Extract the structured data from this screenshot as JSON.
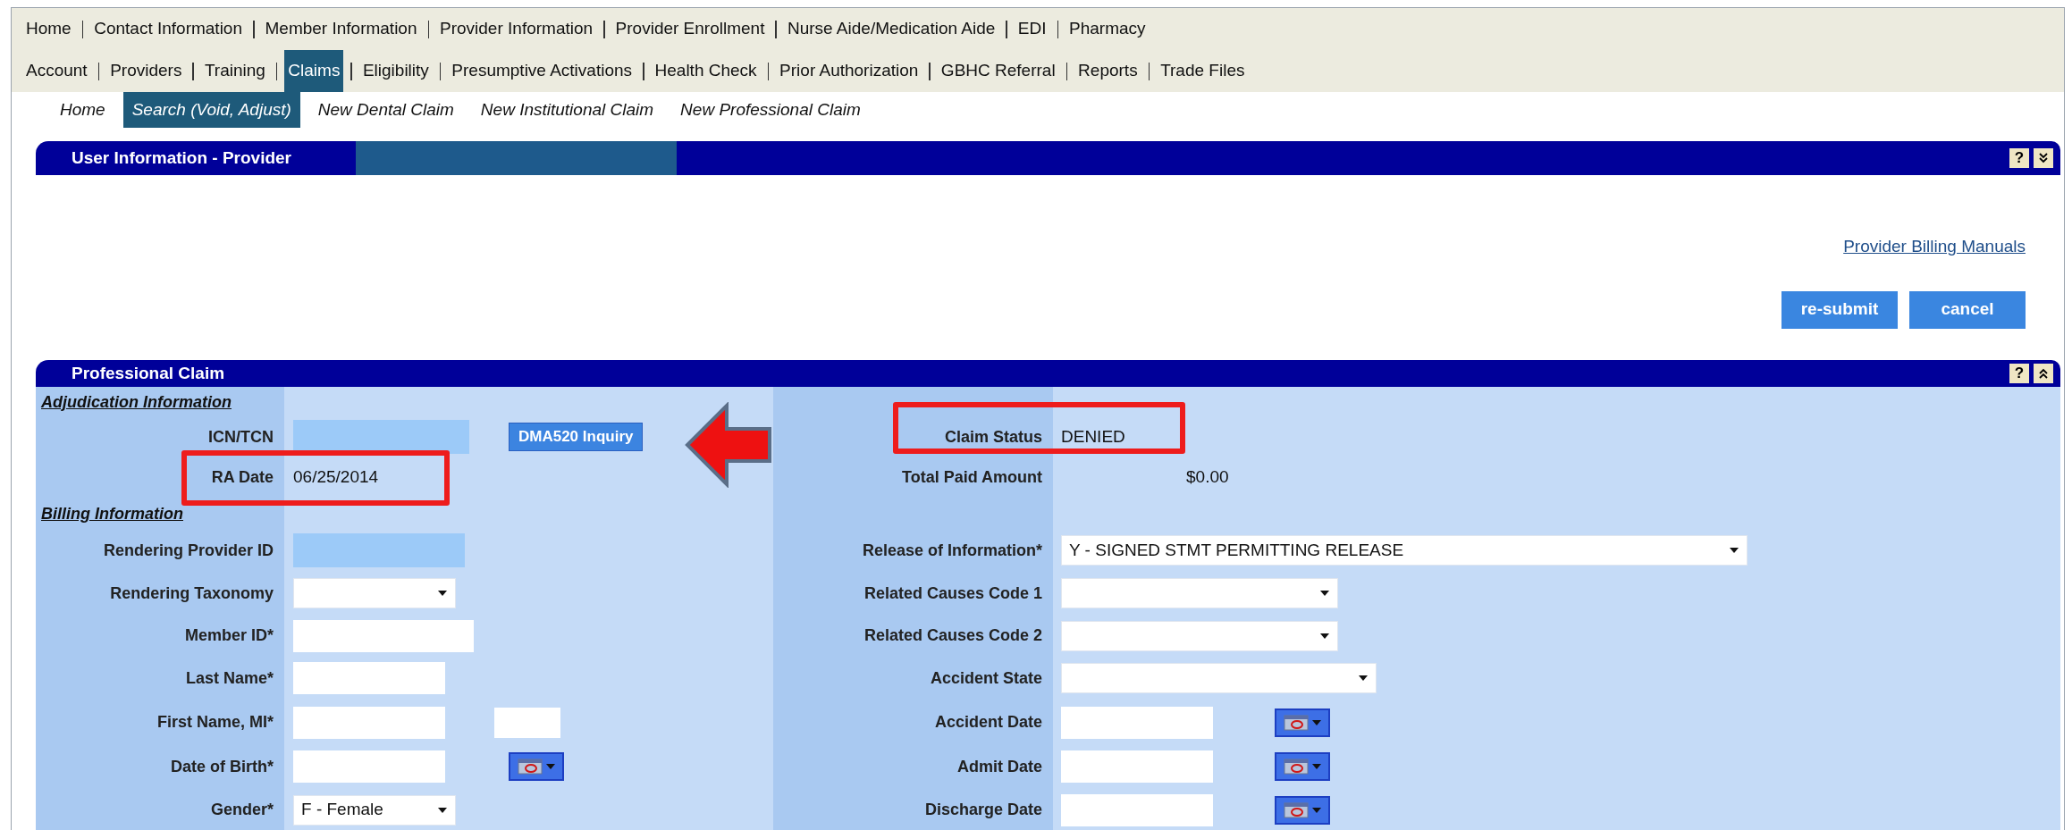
{
  "main_nav": {
    "rows": [
      {
        "items": [
          {
            "label": "Home",
            "selected": false
          },
          {
            "label": "Contact Information",
            "selected": false
          },
          {
            "label": "Member Information",
            "selected": false
          },
          {
            "label": "Provider Information",
            "selected": false
          },
          {
            "label": "Provider Enrollment",
            "selected": false
          },
          {
            "label": "Nurse Aide/Medication Aide",
            "selected": false
          },
          {
            "label": "EDI",
            "selected": false
          },
          {
            "label": "Pharmacy",
            "selected": false
          }
        ]
      },
      {
        "items": [
          {
            "label": "Account",
            "selected": false
          },
          {
            "label": "Providers",
            "selected": false
          },
          {
            "label": "Training",
            "selected": false
          },
          {
            "label": "Claims",
            "selected": true
          },
          {
            "label": "Eligibility",
            "selected": false
          },
          {
            "label": "Presumptive Activations",
            "selected": false
          },
          {
            "label": "Health Check",
            "selected": false
          },
          {
            "label": "Prior Authorization",
            "selected": false
          },
          {
            "label": "GBHC Referral",
            "selected": false
          },
          {
            "label": "Reports",
            "selected": false
          },
          {
            "label": "Trade Files",
            "selected": false
          }
        ]
      }
    ]
  },
  "sub_nav": [
    {
      "label": "Home",
      "selected": false
    },
    {
      "label": "Search (Void, Adjust)",
      "selected": true
    },
    {
      "label": "New Dental Claim",
      "selected": false
    },
    {
      "label": "New Institutional Claim",
      "selected": false
    },
    {
      "label": "New Professional Claim",
      "selected": false
    }
  ],
  "user_panel": {
    "title": "User Information - Provider",
    "help": "?",
    "expanded": false,
    "link": "Provider Billing Manuals",
    "buttons": [
      "re-submit",
      "cancel"
    ]
  },
  "claim_panel": {
    "title": "Professional Claim",
    "help": "?",
    "expanded": true,
    "rows": [
      {
        "left": {
          "kind": "heading",
          "label": "Adjudication Information"
        }
      },
      {
        "left": {
          "kind": "readonly",
          "label": "ICN/TCN",
          "button": "DMA520 Inquiry"
        },
        "right": {
          "kind": "value",
          "label": "Claim Status",
          "value": "DENIED",
          "highlighted": true
        }
      },
      {
        "left": {
          "kind": "value",
          "label": "RA Date",
          "value": "06/25/2014",
          "highlighted": true
        },
        "right": {
          "kind": "amount",
          "label": "Total Paid Amount",
          "value": "$0.00"
        }
      },
      {
        "left": {
          "kind": "heading",
          "label": "Billing Information"
        }
      },
      {
        "left": {
          "kind": "readonly",
          "label": "Rendering Provider ID"
        },
        "right": {
          "kind": "select",
          "label": "Release of Information*",
          "value": "Y - SIGNED STMT PERMITTING RELEASE"
        }
      },
      {
        "left": {
          "kind": "select",
          "label": "Rendering Taxonomy"
        },
        "right": {
          "kind": "select",
          "label": "Related Causes Code 1"
        }
      },
      {
        "left": {
          "kind": "text",
          "label": "Member ID*"
        },
        "right": {
          "kind": "select",
          "label": "Related Causes Code 2"
        }
      },
      {
        "left": {
          "kind": "text",
          "label": "Last Name*"
        },
        "right": {
          "kind": "select",
          "label": "Accident State"
        }
      },
      {
        "left": {
          "kind": "name",
          "label": "First Name, MI*"
        },
        "right": {
          "kind": "date",
          "label": "Accident Date"
        }
      },
      {
        "left": {
          "kind": "date",
          "label": "Date of Birth*"
        },
        "right": {
          "kind": "date",
          "label": "Admit Date"
        }
      },
      {
        "left": {
          "kind": "select",
          "label": "Gender*",
          "value": "F - Female"
        },
        "right": {
          "kind": "date",
          "label": "Discharge Date"
        }
      }
    ]
  }
}
